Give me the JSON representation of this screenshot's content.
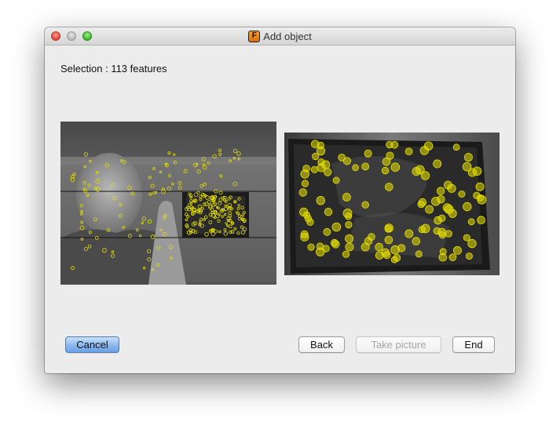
{
  "window": {
    "title": "Add object"
  },
  "app_icon_letter": "F",
  "selection_text": "Selection : 113 features",
  "buttons": {
    "cancel": "Cancel",
    "back": "Back",
    "take_picture": "Take picture",
    "end": "End"
  },
  "colors": {
    "feature_marker": "#e6e000",
    "default_button": "#8ab8ee"
  }
}
